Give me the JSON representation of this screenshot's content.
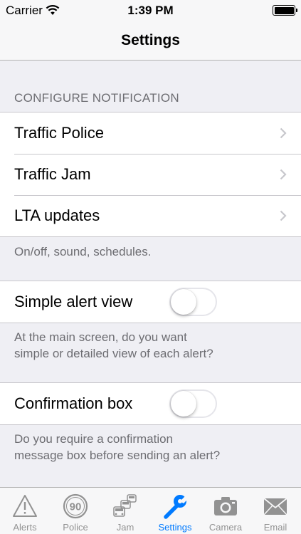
{
  "status_bar": {
    "carrier": "Carrier",
    "time": "1:39 PM",
    "battery_level": 1.0
  },
  "nav": {
    "title": "Settings"
  },
  "notifications": {
    "header": "CONFIGURE NOTIFICATION",
    "items": [
      {
        "label": "Traffic Police"
      },
      {
        "label": "Traffic Jam"
      },
      {
        "label": "LTA updates"
      }
    ],
    "footer": "On/off, sound, schedules."
  },
  "simple_alert": {
    "label": "Simple alert view",
    "enabled": false,
    "footer_line1": "At the main screen, do you want",
    "footer_line2": "simple or detailed view of each alert?"
  },
  "confirmation": {
    "label": "Confirmation box",
    "enabled": false,
    "footer_line1": "Do you require a confirmation",
    "footer_line2": "message box before sending an alert?"
  },
  "tabs": [
    {
      "label": "Alerts",
      "icon": "warning-triangle-icon",
      "active": false
    },
    {
      "label": "Police",
      "icon": "speed-limit-icon",
      "speed_value": "90",
      "active": false
    },
    {
      "label": "Jam",
      "icon": "traffic-cars-icon",
      "active": false
    },
    {
      "label": "Settings",
      "icon": "wrench-icon",
      "active": true
    },
    {
      "label": "Camera",
      "icon": "camera-icon",
      "active": false
    },
    {
      "label": "Email",
      "icon": "envelope-icon",
      "active": false
    }
  ],
  "colors": {
    "accent": "#007aff",
    "inactive": "#929292",
    "background": "#efeff4",
    "separator": "#c8c7cc"
  }
}
